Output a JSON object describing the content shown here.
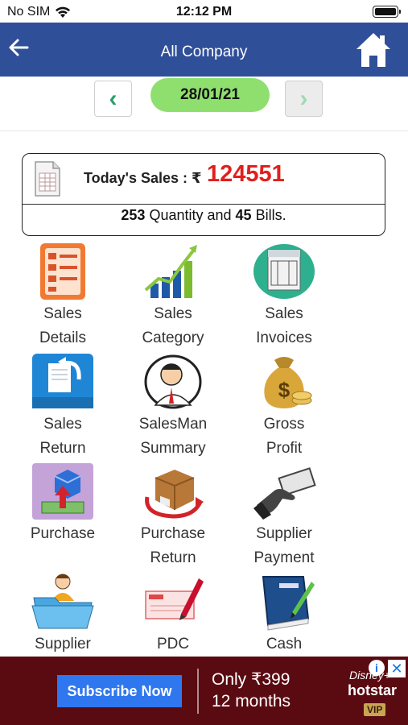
{
  "status_bar": {
    "carrier": "No SIM",
    "time": "12:12 PM"
  },
  "header": {
    "title": "All Company"
  },
  "date_nav": {
    "prev": "‹",
    "date": "28/01/21",
    "next": "›"
  },
  "summary": {
    "label": "Today's Sales : ₹",
    "amount": "124551",
    "quantity": "253",
    "quantity_text": "Quantity and",
    "bills": "45",
    "bills_text": "Bills."
  },
  "tiles": [
    {
      "line1": "Sales",
      "line2": "Details"
    },
    {
      "line1": "Sales",
      "line2": "Category"
    },
    {
      "line1": "Sales",
      "line2": "Invoices"
    },
    {
      "line1": "Sales",
      "line2": "Return"
    },
    {
      "line1": "SalesMan",
      "line2": "Summary"
    },
    {
      "line1": "Gross",
      "line2": "Profit"
    },
    {
      "line1": "Purchase",
      "line2": ""
    },
    {
      "line1": "Purchase",
      "line2": "Return"
    },
    {
      "line1": "Supplier",
      "line2": "Payment"
    },
    {
      "line1": "Supplier",
      "line2": ""
    },
    {
      "line1": "PDC",
      "line2": ""
    },
    {
      "line1": "Cash",
      "line2": ""
    }
  ],
  "ad": {
    "button": "Subscribe Now",
    "line1": "Only ₹399",
    "line2": "12 months",
    "brand_top": "Disney+",
    "brand": "hotstar",
    "badge": "VIP",
    "info": "i",
    "close": "✕"
  },
  "colors": {
    "nav": "#2f4f99",
    "date_pill": "#8fdf6f",
    "sales_amount": "#e0201f",
    "ad_bg": "#5a0b12"
  }
}
